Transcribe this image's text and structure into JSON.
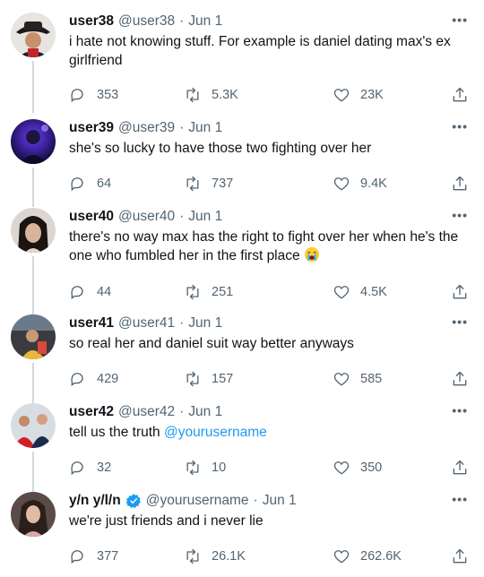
{
  "colors": {
    "link": "#1d9bf0",
    "muted": "#536471",
    "line": "#cfd9de"
  },
  "tweets": [
    {
      "name": "user38",
      "handle": "@user38",
      "date": "Jun 1",
      "text": "i hate not knowing stuff. For example is daniel dating max's ex girlfriend",
      "replies": "353",
      "retweets": "5.3K",
      "likes": "23K"
    },
    {
      "name": "user39",
      "handle": "@user39",
      "date": "Jun 1",
      "text": "she's so lucky to have those two fighting over her",
      "replies": "64",
      "retweets": "737",
      "likes": "9.4K"
    },
    {
      "name": "user40",
      "handle": "@user40",
      "date": "Jun 1",
      "text": "there's no way max has the right to fight over her when he's the one who fumbled her in the first place",
      "replies": "44",
      "retweets": "251",
      "likes": "4.5K"
    },
    {
      "name": "user41",
      "handle": "@user41",
      "date": "Jun 1",
      "text": "so real her and daniel suit way better anyways",
      "replies": "429",
      "retweets": "157",
      "likes": "585"
    },
    {
      "name": "user42",
      "handle": "@user42",
      "date": "Jun 1",
      "text": "tell us the truth",
      "mention": "@yourusername",
      "replies": "32",
      "retweets": "10",
      "likes": "350"
    },
    {
      "name": "y/n y/l/n",
      "handle": "@yourusername",
      "date": "Jun 1",
      "text": "we're just friends and i never lie",
      "replies": "377",
      "retweets": "26.1K",
      "likes": "262.6K"
    }
  ],
  "dot": "·",
  "more": "•••"
}
